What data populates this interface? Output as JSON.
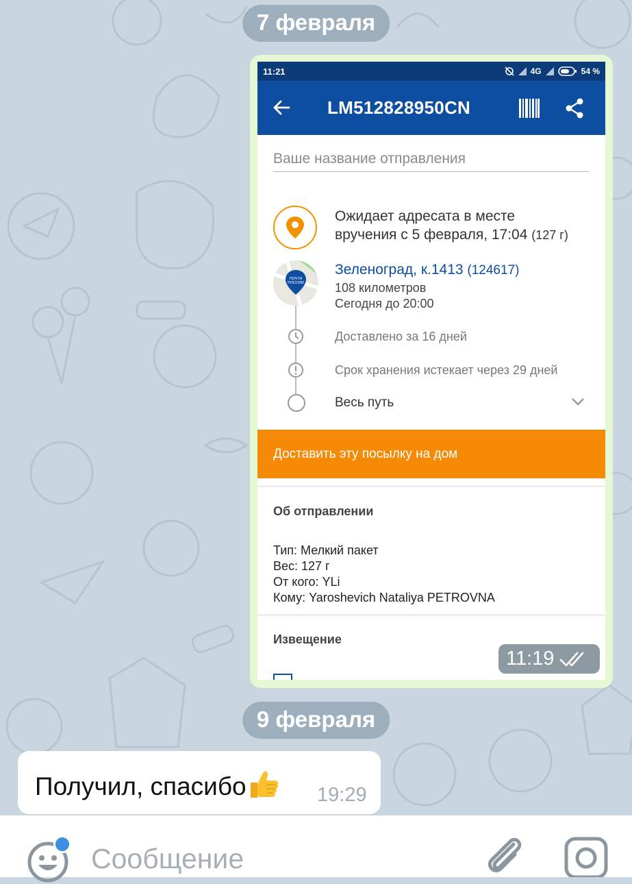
{
  "chat": {
    "date_1": "7 февраля",
    "date_2": "9 февраля",
    "photo_message": {
      "time": "11:19",
      "status_icon": "double-check-icon"
    },
    "incoming_message": {
      "text": "Получил, спасибо",
      "emoji": "thumbs-up",
      "time": "19:29"
    }
  },
  "screenshot": {
    "status_bar": {
      "time": "11:21",
      "network": "4G",
      "battery": "54 %"
    },
    "app_bar": {
      "title": "LM512828950CN",
      "back_icon": "arrow-left-icon",
      "barcode_icon": "barcode-icon",
      "share_icon": "share-icon"
    },
    "name_field_placeholder": "Ваше название отправления",
    "status": {
      "line1": "Ожидает адресата в месте",
      "line2": "вручения с 5 февраля, 17:04",
      "weight": "(127 г)"
    },
    "office": {
      "name": "Зеленоград, к.1413",
      "index": "(124617)",
      "distance": "108 километров",
      "hours": "Сегодня до 20:00",
      "map_label": "ПОЧТА РОССИИ"
    },
    "delivered_in": "Доставлено за 16 дней",
    "storage": "Срок хранения истекает через 29 дней",
    "full_path": "Весь путь",
    "deliver_button": "Доставить эту посылку на дом",
    "about": {
      "title": "Об отправлении",
      "type": "Тип: Мелкий пакет",
      "weight": "Вес: 127 г",
      "from": "От кого: YLi",
      "to": "Кому: Yaroshevich Nataliya PETROVNA"
    },
    "notice_title": "Извещение"
  },
  "input": {
    "placeholder": "Сообщение"
  },
  "colors": {
    "app_blue": "#0e4ea0",
    "orange": "#f58a07",
    "outgoing_bubble": "#e6f7d3",
    "chat_bg": "#c9d6e0"
  }
}
